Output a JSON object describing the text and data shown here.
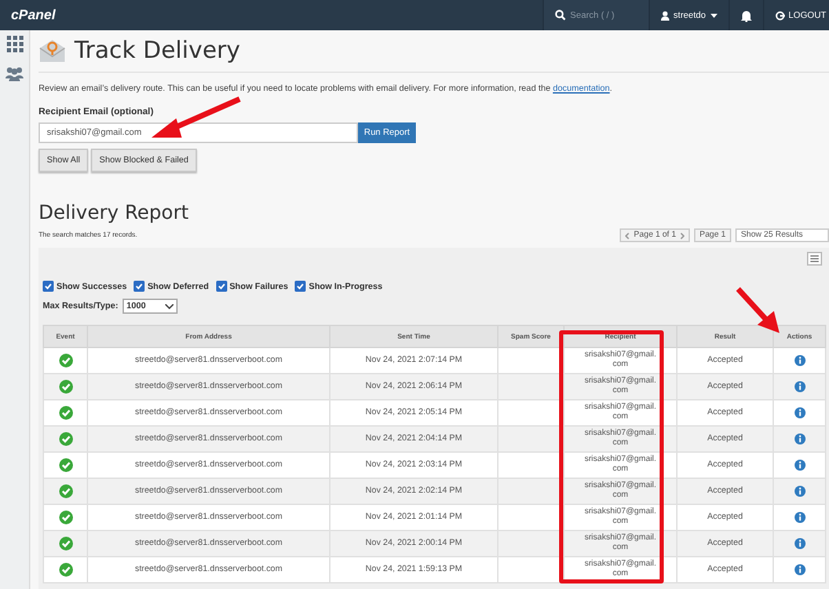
{
  "topbar": {
    "logo": "cPanel",
    "search_placeholder": "Search ( / )",
    "user": "streetdo",
    "logout": "LOGOUT"
  },
  "page": {
    "title": "Track Delivery",
    "description": "Review an email’s delivery route. This can be useful if you need to locate problems with email delivery. For more information, read the ",
    "link": "documentation",
    "description_end": "."
  },
  "form": {
    "label": "Recipient Email (optional)",
    "value": "srisakshi07@gmail.com",
    "run_button": "Run Report",
    "buttons": [
      "Show All",
      "Show Blocked & Failed"
    ]
  },
  "report": {
    "title": "Delivery Report",
    "summary": "The search matches 17 records.",
    "pager": "Page 1 of 1",
    "page_select": "Page 1",
    "results_select": "Show 25 Results",
    "filters": [
      {
        "label": "Show Successes",
        "checked": true
      },
      {
        "label": "Show Deferred",
        "checked": true
      },
      {
        "label": "Show Failures",
        "checked": true
      },
      {
        "label": "Show In-Progress",
        "checked": true
      }
    ],
    "max_label": "Max Results/Type:",
    "max_value": "1000"
  },
  "table": {
    "columns": [
      "Event",
      "From Address",
      "Sent Time",
      "Spam Score",
      "Recipient",
      "Result",
      "Actions"
    ],
    "rows": [
      {
        "success": true,
        "from": "streetdo@server81.dnsserverboot.com",
        "sent": "Nov 24, 2021 2:07:14 PM",
        "recipient": "srisakshi07@gmail.com",
        "result": "Accepted"
      },
      {
        "success": true,
        "from": "streetdo@server81.dnsserverboot.com",
        "sent": "Nov 24, 2021 2:06:14 PM",
        "recipient": "srisakshi07@gmail.com",
        "result": "Accepted"
      },
      {
        "success": true,
        "from": "streetdo@server81.dnsserverboot.com",
        "sent": "Nov 24, 2021 2:05:14 PM",
        "recipient": "srisakshi07@gmail.com",
        "result": "Accepted"
      },
      {
        "success": true,
        "from": "streetdo@server81.dnsserverboot.com",
        "sent": "Nov 24, 2021 2:04:14 PM",
        "recipient": "srisakshi07@gmail.com",
        "result": "Accepted"
      },
      {
        "success": true,
        "from": "streetdo@server81.dnsserverboot.com",
        "sent": "Nov 24, 2021 2:03:14 PM",
        "recipient": "srisakshi07@gmail.com",
        "result": "Accepted"
      },
      {
        "success": true,
        "from": "streetdo@server81.dnsserverboot.com",
        "sent": "Nov 24, 2021 2:02:14 PM",
        "recipient": "srisakshi07@gmail.com",
        "result": "Accepted"
      },
      {
        "success": true,
        "from": "streetdo@server81.dnsserverboot.com",
        "sent": "Nov 24, 2021 2:01:14 PM",
        "recipient": "srisakshi07@gmail.com",
        "result": "Accepted"
      },
      {
        "success": true,
        "from": "streetdo@server81.dnsserverboot.com",
        "sent": "Nov 24, 2021 2:00:14 PM",
        "recipient": "srisakshi07@gmail.com",
        "result": "Accepted"
      },
      {
        "success": true,
        "from": "streetdo@server81.dnsserverboot.com",
        "sent": "Nov 24, 2021 1:59:13 PM",
        "recipient": "srisakshi07@gmail.com",
        "result": "Accepted"
      }
    ]
  }
}
